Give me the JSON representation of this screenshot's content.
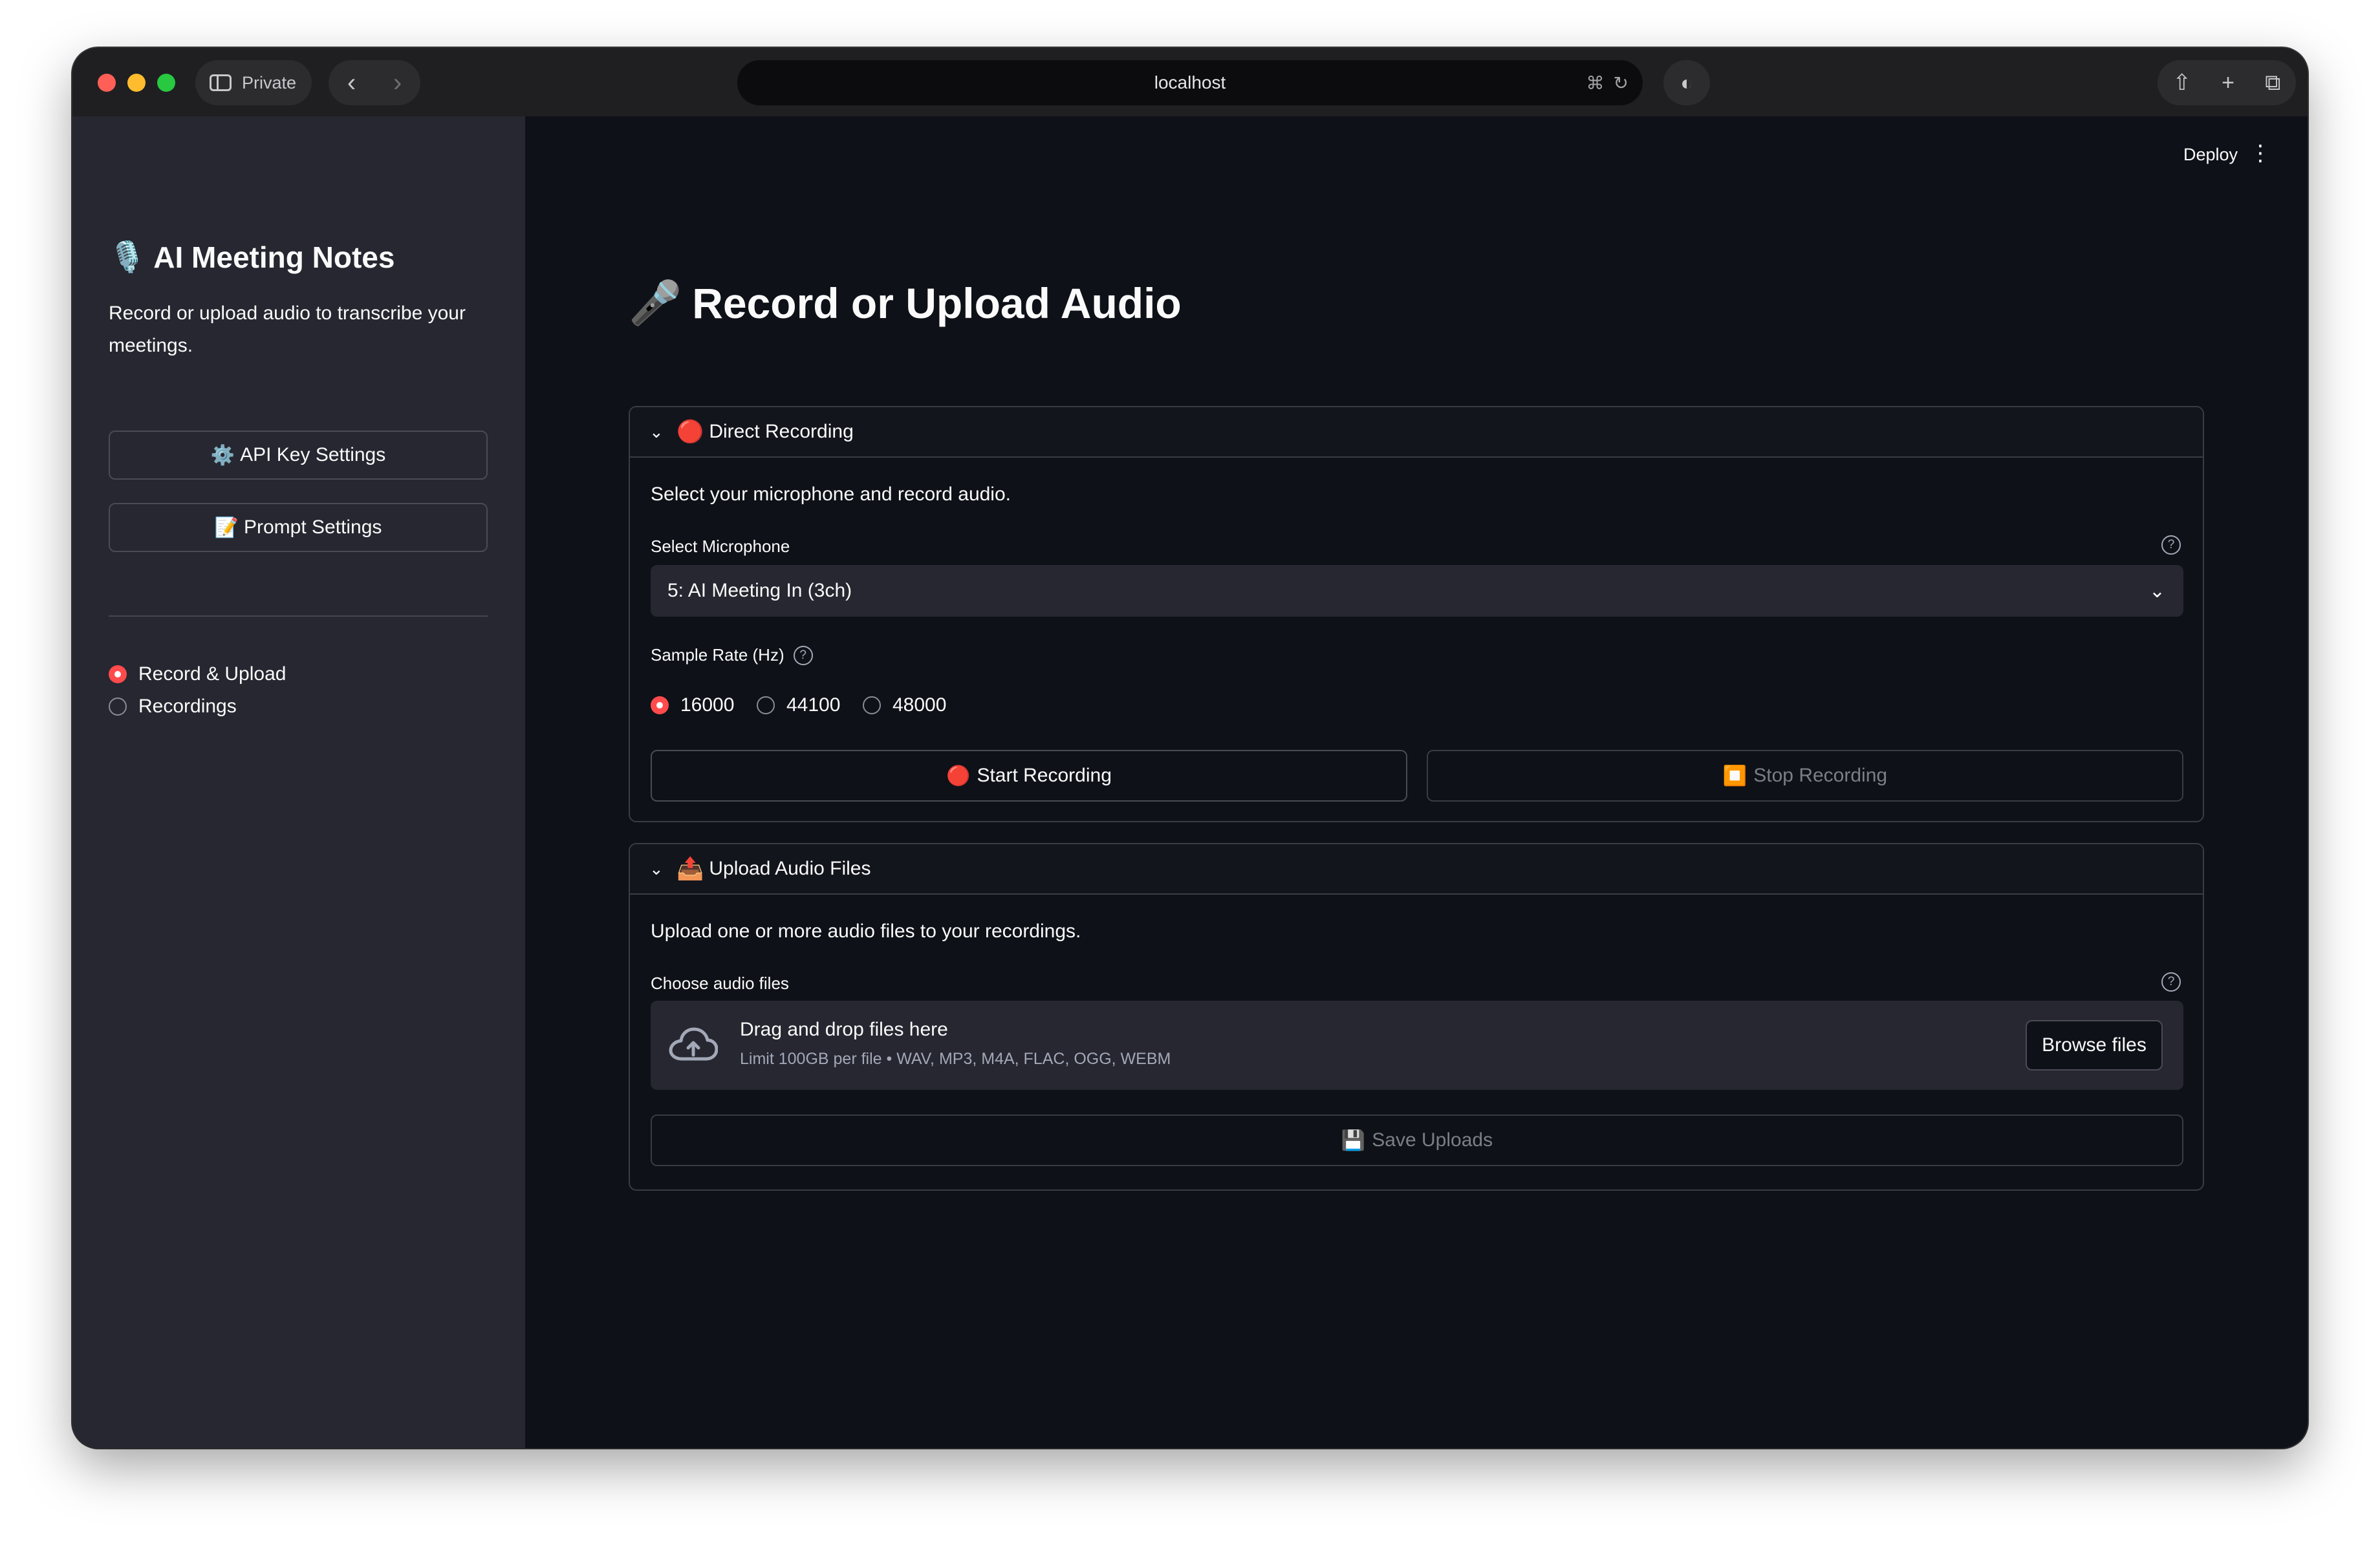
{
  "browser": {
    "private_label": "Private",
    "url": "localhost"
  },
  "sidebar": {
    "title_icon": "🎙️",
    "title": "AI Meeting Notes",
    "description": "Record or upload audio to transcribe your meetings.",
    "buttons": [
      {
        "icon": "⚙️",
        "label": "API Key Settings"
      },
      {
        "icon": "📝",
        "label": "Prompt Settings"
      }
    ],
    "nav": [
      {
        "label": "Record & Upload",
        "selected": true
      },
      {
        "label": "Recordings",
        "selected": false
      }
    ]
  },
  "header": {
    "deploy_label": "Deploy"
  },
  "main": {
    "title_icon": "🎤",
    "title": "Record or Upload Audio",
    "recording": {
      "header_icon": "🔴",
      "header_label": "Direct Recording",
      "intro": "Select your microphone and record audio.",
      "mic_label": "Select Microphone",
      "mic_value": "5: AI Meeting In (3ch)",
      "sample_rate_label": "Sample Rate (Hz)",
      "sample_rates": [
        {
          "label": "16000",
          "selected": true
        },
        {
          "label": "44100",
          "selected": false
        },
        {
          "label": "48000",
          "selected": false
        }
      ],
      "start_icon": "🔴",
      "start_label": "Start Recording",
      "stop_icon": "⏹️",
      "stop_label": "Stop Recording"
    },
    "upload": {
      "header_icon": "📤",
      "header_label": "Upload Audio Files",
      "intro": "Upload one or more audio files to your recordings.",
      "files_label": "Choose audio files",
      "drop_text": "Drag and drop files here",
      "drop_limit": "Limit 100GB per file • WAV, MP3, M4A, FLAC, OGG, WEBM",
      "browse_label": "Browse files",
      "save_icon": "💾",
      "save_label": "Save Uploads"
    }
  },
  "colors": {
    "accent": "#ff4b4b",
    "sidebar_bg": "#262730",
    "main_bg": "#0e1117"
  }
}
